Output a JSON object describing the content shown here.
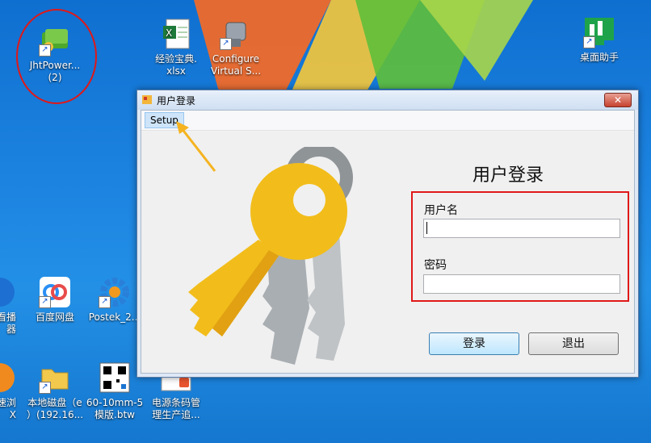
{
  "desktop": {
    "icons": [
      {
        "label": "JhtPower...\n(2)"
      },
      {
        "label": "经验宝典.\nxlsx"
      },
      {
        "label": "Configure\nVirtual S..."
      },
      {
        "label": "桌面助手"
      },
      {
        "label": "看播\n器"
      },
      {
        "label": "百度网盘"
      },
      {
        "label": "Postek_2..."
      },
      {
        "label": "速浏\nX"
      },
      {
        "label": "本地磁盘（e\n）(192.16..."
      },
      {
        "label": "60-10mm-5\n模版.btw"
      },
      {
        "label": "电源条码管\n理生产追..."
      }
    ]
  },
  "window": {
    "title": "用户登录",
    "close_symbol": "✕",
    "menu": {
      "setup": "Setup"
    },
    "form": {
      "heading": "用户登录",
      "username_label": "用户名",
      "username_value": "",
      "password_label": "密码",
      "password_value": "",
      "login_button": "登录",
      "exit_button": "退出"
    }
  },
  "colors": {
    "annotation": "#e01818",
    "key_gold": "#f2bd1b",
    "key_gray": "#a9aeb2",
    "accent": "#f5b320"
  }
}
